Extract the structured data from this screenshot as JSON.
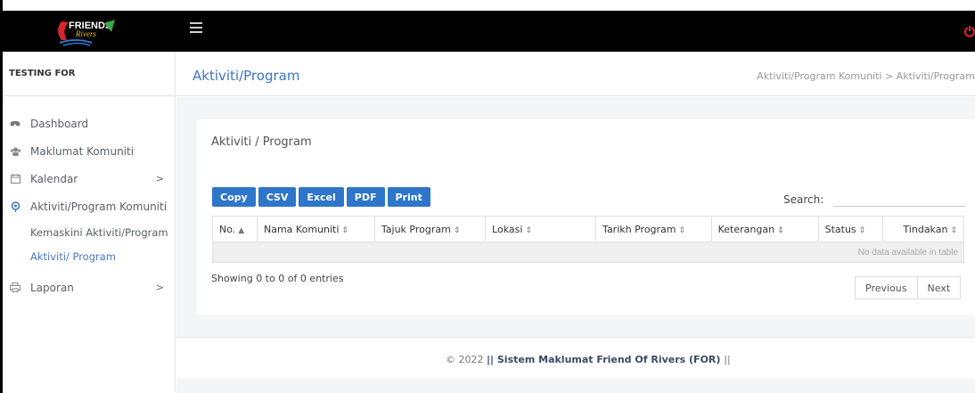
{
  "header": {
    "logo_text": "FRIENDS Rivers",
    "menu_icon": "hamburger-icon",
    "power_icon": "power-icon"
  },
  "sidebar": {
    "brand": "TESTING FOR",
    "items": [
      {
        "label": "Dashboard",
        "icon": "dashboard-icon"
      },
      {
        "label": "Maklumat Komuniti",
        "icon": "users-icon"
      },
      {
        "label": "Kalendar",
        "icon": "calendar-icon",
        "chevron": ">"
      },
      {
        "label": "Aktiviti/Program Komuniti",
        "icon": "location-icon",
        "chevron": ">"
      },
      {
        "label": "Laporan",
        "icon": "printer-icon",
        "chevron": ">"
      }
    ],
    "subitems": [
      {
        "label": "Kemaskini Aktiviti/Program"
      },
      {
        "label": "Aktiviti/ Program"
      }
    ]
  },
  "page": {
    "title": "Aktiviti/Program",
    "breadcrumb": "Aktiviti/Program Komuniti  >  Aktiviti/Program"
  },
  "card": {
    "title": "Aktiviti / Program",
    "buttons": [
      "Copy",
      "CSV",
      "Excel",
      "PDF",
      "Print"
    ],
    "search_label": "Search:",
    "search_value": ""
  },
  "table": {
    "columns": [
      "No.",
      "Nama Komuniti",
      "Tajuk Program",
      "Lokasi",
      "Tarikh Program",
      "Keterangan",
      "Status",
      "Tindakan"
    ],
    "sort_asc": "▲",
    "sort_both": "⇕",
    "empty_text": "No data available in table"
  },
  "pagination": {
    "info": "Showing 0 to 0 of 0 entries",
    "previous": "Previous",
    "next": "Next"
  },
  "footer": {
    "prefix": "© 2022 ",
    "bars_left": "||",
    "title": " Sistem Maklumat Friend Of Rivers (FOR) ",
    "bars_right": "||"
  },
  "colors": {
    "accent": "#2e76c9",
    "title": "#3d74c4",
    "topbar": "#000000",
    "power": "#e52222"
  }
}
